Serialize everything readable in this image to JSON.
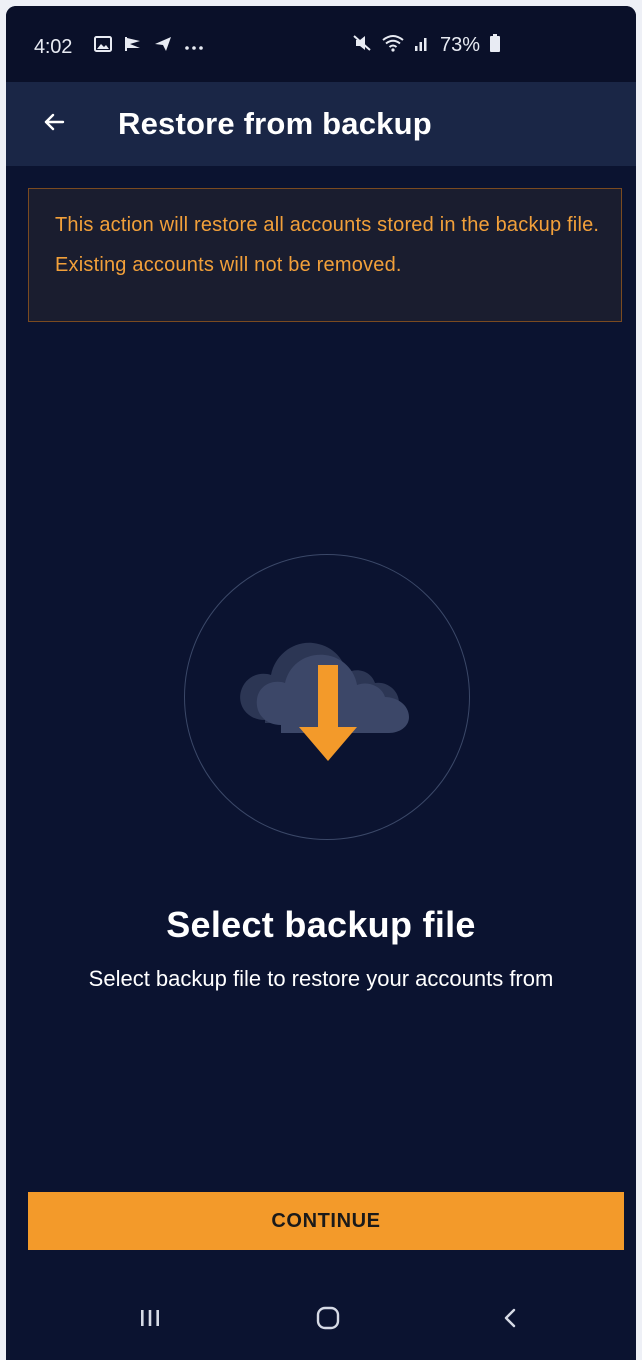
{
  "status_bar": {
    "time": "4:02",
    "battery_percent": "73%",
    "left_icons": [
      "gallery-icon",
      "flag-icon",
      "send-icon",
      "more-dots-icon"
    ],
    "right_icons": [
      "mute-icon",
      "wifi-icon",
      "signal-icon",
      "battery-icon"
    ]
  },
  "app_bar": {
    "back_icon": "arrow-left-icon",
    "title": "Restore from backup"
  },
  "warning": {
    "text": "This action will restore all accounts stored in the backup file. Existing accounts will not be removed."
  },
  "illustration": {
    "icon": "cloud-download-icon"
  },
  "content": {
    "heading": "Select backup file",
    "subheading": "Select backup file to restore your accounts from"
  },
  "continue_button": {
    "label": "CONTINUE"
  },
  "nav_bar": {
    "recents_icon": "recents-icon",
    "home_icon": "home-icon",
    "back_icon": "nav-back-icon"
  },
  "colors": {
    "background": "#0b1330",
    "app_bar": "#1a2646",
    "accent": "#f39a2a",
    "warning_text": "#f2a03a"
  }
}
